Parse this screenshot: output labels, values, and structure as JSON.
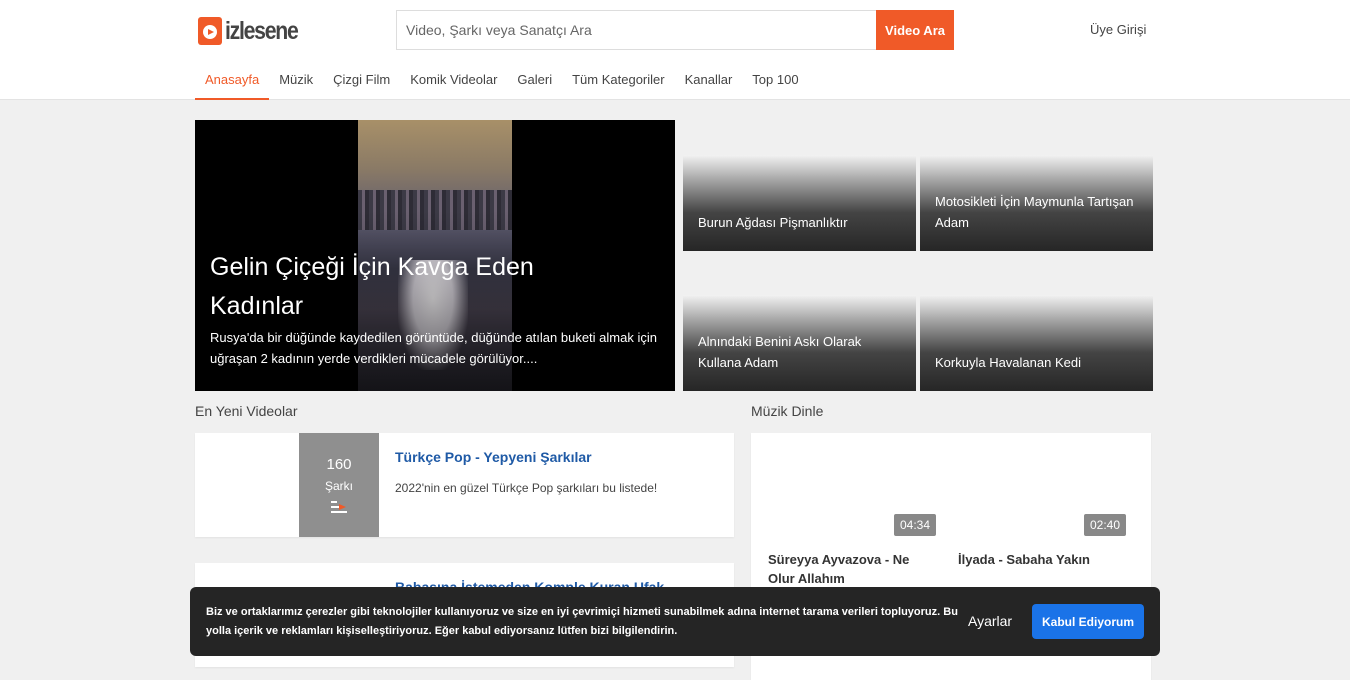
{
  "header": {
    "logo_text": "izlesene",
    "search_placeholder": "Video, Şarkı veya Sanatçı Ara",
    "search_button": "Video Ara",
    "login": "Üye Girişi"
  },
  "nav": {
    "items": [
      {
        "label": "Anasayfa",
        "active": true
      },
      {
        "label": "Müzik"
      },
      {
        "label": "Çizgi Film"
      },
      {
        "label": "Komik Videolar"
      },
      {
        "label": "Galeri"
      },
      {
        "label": "Tüm Kategoriler"
      },
      {
        "label": "Kanallar"
      },
      {
        "label": "Top 100"
      }
    ]
  },
  "featured": {
    "title": "Gelin Çiçeği İçin Kavga Eden Kadınlar",
    "description": "Rusya'da bir düğünde kaydedilen görüntüde, düğünde atılan buketi almak için uğraşan 2 kadının yerde verdikleri mücadele görülüyor....",
    "tiles": [
      {
        "title": "Burun Ağdası Pişmanlıktır"
      },
      {
        "title": "Motosikleti İçin Maymunla Tartışan Adam"
      },
      {
        "title": "Alnındaki Benini Askı Olarak Kullana Adam"
      },
      {
        "title": "Korkuyla Havalanan Kedi"
      }
    ]
  },
  "newest": {
    "section_title": "En Yeni Videolar",
    "playlist": {
      "count": "160",
      "unit": "Şarkı",
      "title": "Türkçe Pop - Yepyeni Şarkılar",
      "description": "2022'nin en güzel Türkçe Pop şarkıları bu listede!"
    },
    "second_card_title": "Babasına İstemeden Komple Kuran Ufak..."
  },
  "music": {
    "section_title": "Müzik Dinle",
    "items": [
      {
        "duration": "04:34",
        "title": "Süreyya Ayvazova - Ne Olur Allahım"
      },
      {
        "duration": "02:40",
        "title": "İlyada - Sabaha Yakın"
      }
    ]
  },
  "cookie": {
    "text": "Biz ve ortaklarımız çerezler gibi teknolojiler kullanıyoruz ve size en iyi çevrimiçi hizmeti sunabilmek adına internet tarama verileri topluyoruz. Bu yolla içerik ve reklamları kişiselleştiriyoruz. Eğer kabul ediyorsanız lütfen bizi bilgilendirin.",
    "settings": "Ayarlar",
    "accept": "Kabul Ediyorum"
  },
  "colors": {
    "accent": "#f05a28",
    "link": "#1f5aa6",
    "cookie_button": "#1a73e8"
  }
}
